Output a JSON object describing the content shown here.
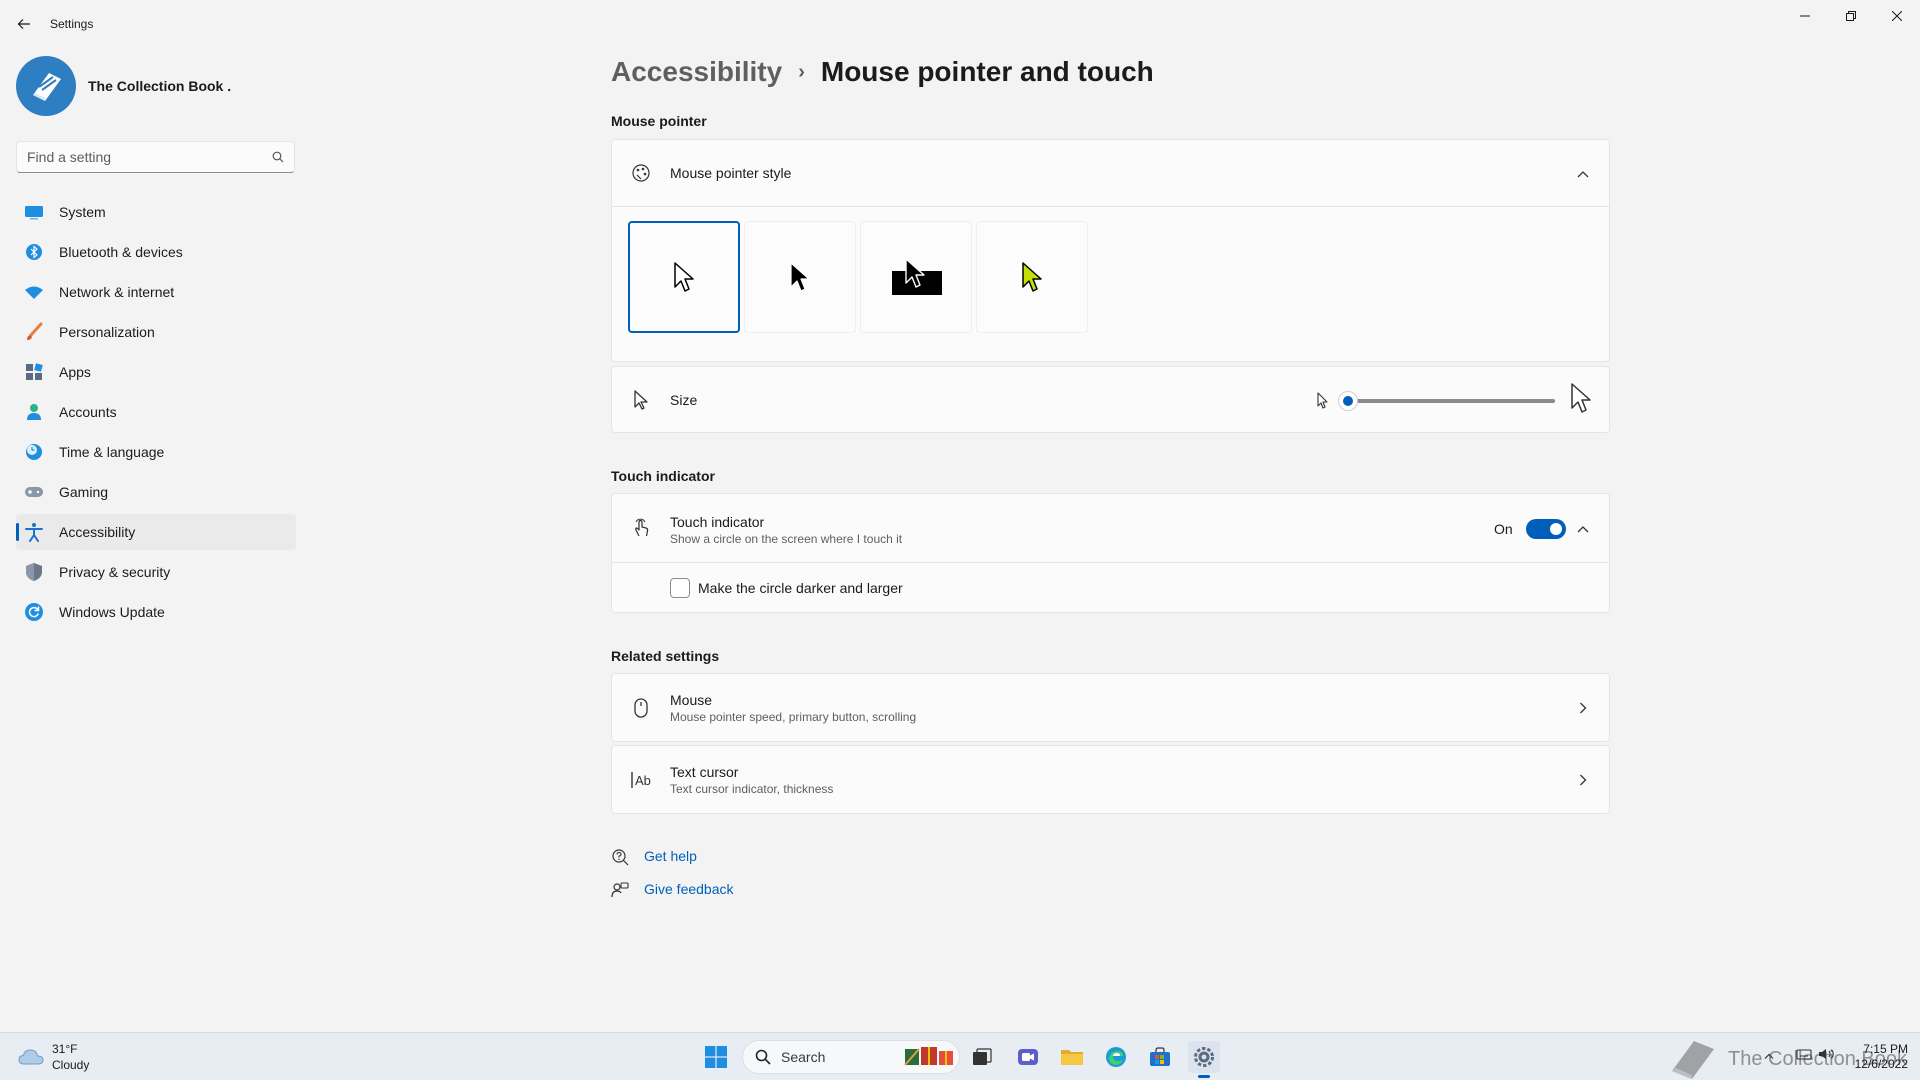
{
  "window": {
    "title": "Settings"
  },
  "profile": {
    "name": "The Collection Book ."
  },
  "search": {
    "placeholder": "Find a setting"
  },
  "sidebar": {
    "items": [
      {
        "label": "System",
        "icon": "system-icon"
      },
      {
        "label": "Bluetooth & devices",
        "icon": "bluetooth-icon"
      },
      {
        "label": "Network & internet",
        "icon": "wifi-icon"
      },
      {
        "label": "Personalization",
        "icon": "brush-icon"
      },
      {
        "label": "Apps",
        "icon": "apps-icon"
      },
      {
        "label": "Accounts",
        "icon": "person-icon"
      },
      {
        "label": "Time & language",
        "icon": "clock-globe-icon"
      },
      {
        "label": "Gaming",
        "icon": "gamepad-icon"
      },
      {
        "label": "Accessibility",
        "icon": "accessibility-icon",
        "active": true
      },
      {
        "label": "Privacy & security",
        "icon": "shield-icon"
      },
      {
        "label": "Windows Update",
        "icon": "update-icon"
      }
    ]
  },
  "breadcrumb": {
    "parent": "Accessibility",
    "separator": "›",
    "current": "Mouse pointer and touch"
  },
  "mouse_pointer": {
    "section_title": "Mouse pointer",
    "style_title": "Mouse pointer style",
    "styles": [
      {
        "name": "White",
        "selected": true
      },
      {
        "name": "Black",
        "selected": false
      },
      {
        "name": "Inverted",
        "selected": false
      },
      {
        "name": "Custom",
        "selected": false,
        "color": "#c5e000"
      }
    ],
    "size_label": "Size",
    "size_value_fraction": 0.0
  },
  "touch_indicator": {
    "section_title": "Touch indicator",
    "title": "Touch indicator",
    "subtitle": "Show a circle on the screen where I touch it",
    "toggle_label": "On",
    "toggle_on": true,
    "checkbox_label": "Make the circle darker and larger",
    "checkbox_checked": false
  },
  "related": {
    "section_title": "Related settings",
    "items": [
      {
        "title": "Mouse",
        "subtitle": "Mouse pointer speed, primary button, scrolling",
        "icon": "mouse-icon"
      },
      {
        "title": "Text cursor",
        "subtitle": "Text cursor indicator, thickness",
        "icon": "text-cursor-icon"
      }
    ]
  },
  "help": {
    "get_help": "Get help",
    "give_feedback": "Give feedback"
  },
  "taskbar": {
    "weather_temp": "31°F",
    "weather_desc": "Cloudy",
    "search_label": "Search",
    "watermark": "The Collection Book",
    "time": "7:15 PM",
    "date": "12/6/2022"
  },
  "colors": {
    "accent": "#005fb8",
    "background": "#f3f3f3",
    "card": "#fbfbfb"
  }
}
